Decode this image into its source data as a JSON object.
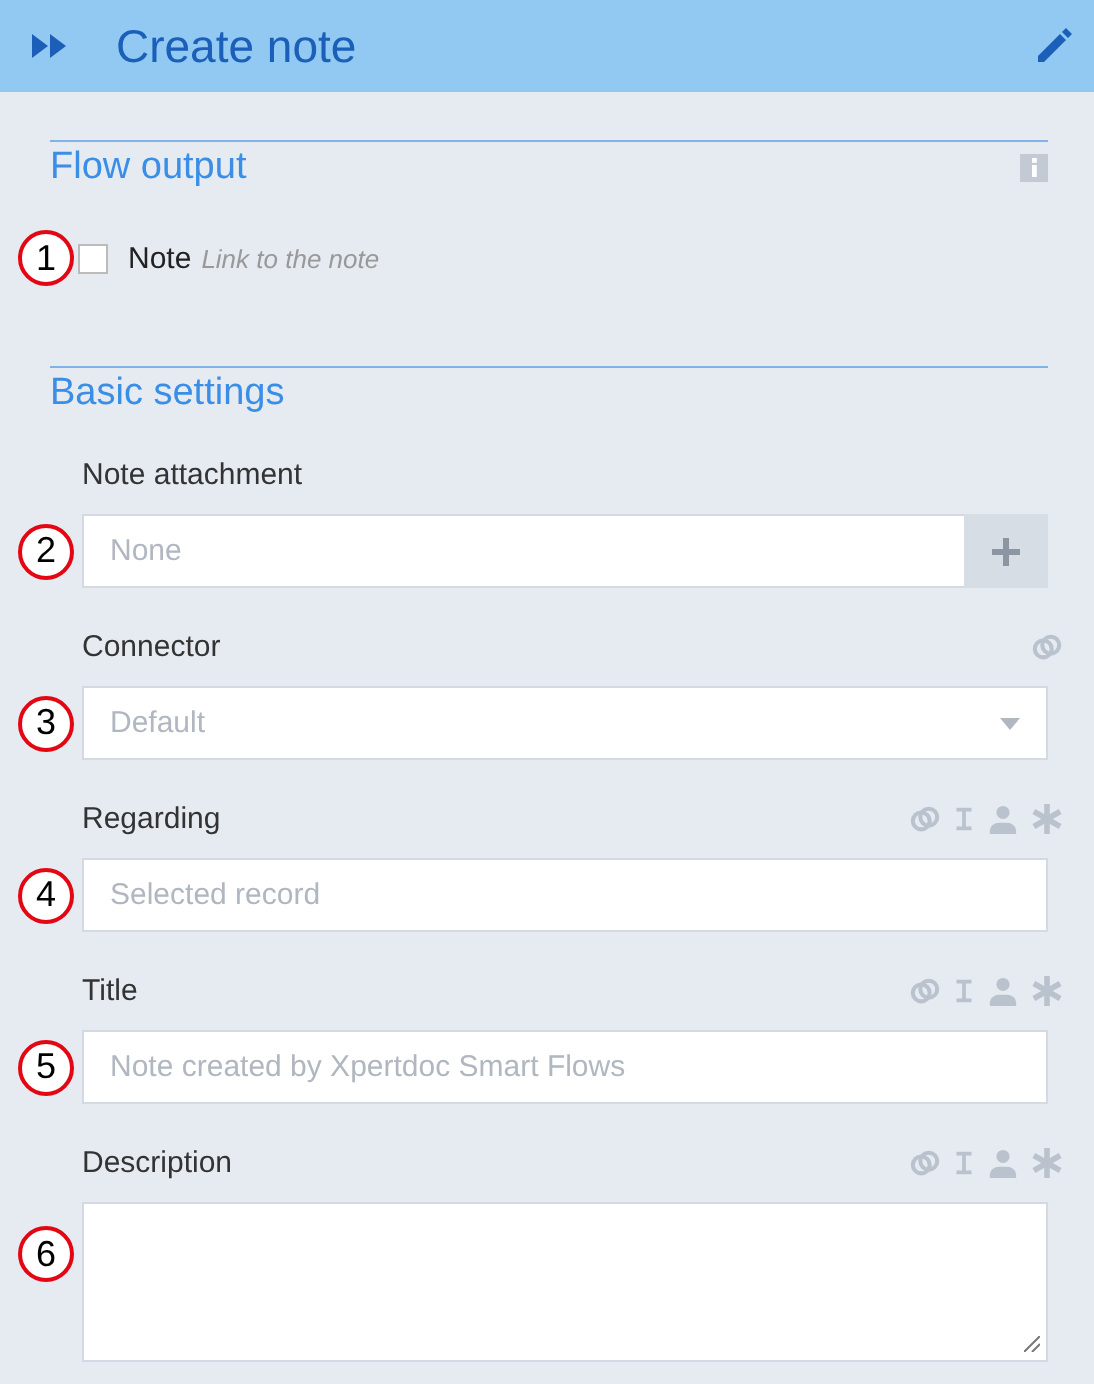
{
  "header": {
    "title": "Create note"
  },
  "sections": [
    {
      "title": "Flow output",
      "info": true,
      "checkbox": {
        "marker": "1",
        "label": "Note",
        "hint": "Link to the note",
        "checked": false
      }
    },
    {
      "title": "Basic settings",
      "info": false,
      "fields": [
        {
          "kind": "add",
          "marker": "2",
          "label": "Note attachment",
          "placeholder": "None",
          "link": false,
          "formula": false,
          "user": false,
          "required": false
        },
        {
          "kind": "select",
          "marker": "3",
          "label": "Connector",
          "placeholder": "Default",
          "link": true,
          "formula": false,
          "user": false,
          "required": false
        },
        {
          "kind": "text",
          "marker": "4",
          "label": "Regarding",
          "placeholder": "Selected record",
          "link": true,
          "formula": true,
          "user": true,
          "required": true
        },
        {
          "kind": "text",
          "marker": "5",
          "label": "Title",
          "placeholder": "Note created by Xpertdoc Smart Flows",
          "link": true,
          "formula": true,
          "user": true,
          "required": true
        },
        {
          "kind": "textarea",
          "marker": "6",
          "label": "Description",
          "link": true,
          "formula": true,
          "user": true,
          "required": true
        }
      ]
    }
  ]
}
